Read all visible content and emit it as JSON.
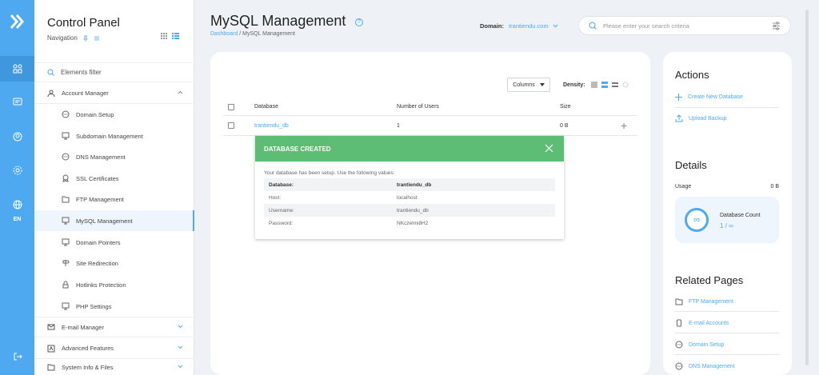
{
  "rail": {
    "lang": "EN",
    "icons": [
      "logo-icon",
      "dashboard-icon",
      "chat-icon",
      "user-icon",
      "settings-icon",
      "globe-icon",
      "logout-icon"
    ]
  },
  "nav": {
    "title": "Control Panel",
    "subtitle": "Navigation",
    "filter": "Elements filter",
    "sections": [
      {
        "label": "Account Manager"
      },
      {
        "label": "E-mail Manager"
      },
      {
        "label": "Advanced Features"
      },
      {
        "label": "System Info & Files"
      }
    ],
    "children": [
      {
        "label": "Domain Setup"
      },
      {
        "label": "Subdomain Management"
      },
      {
        "label": "DNS Management"
      },
      {
        "label": "SSL Certificates"
      },
      {
        "label": "FTP Management"
      },
      {
        "label": "MySQL Management"
      },
      {
        "label": "Domain Pointers"
      },
      {
        "label": "Site Redirection"
      },
      {
        "label": "Hotlinks Protection"
      },
      {
        "label": "PHP Settings"
      }
    ]
  },
  "header": {
    "title": "MySQL Management",
    "breadcrumb_link": "Dashboard",
    "breadcrumb_sep": "/",
    "breadcrumb_current": "MySQL Management",
    "domain_label": "Domain:",
    "domain_value": "trantiendu.com",
    "search_placeholder": "Please enter your search criteria"
  },
  "table": {
    "columns_button": "Columns",
    "density_label": "Density:",
    "headers": {
      "database": "Database",
      "users": "Number of Users",
      "size": "Size"
    },
    "rows": [
      {
        "database": "trantiendu_db",
        "users": "1",
        "size": "0 B"
      }
    ]
  },
  "modal": {
    "title": "DATABASE CREATED",
    "message": "Your database has been setup. Use the following values:",
    "fields": [
      {
        "key": "Database:",
        "value": "trantiendu_db"
      },
      {
        "key": "Host:",
        "value": "localhost"
      },
      {
        "key": "Username:",
        "value": "trantiendu_db"
      },
      {
        "key": "Password:",
        "value": "NKczelmi8H2"
      }
    ]
  },
  "actions": {
    "title": "Actions",
    "create": "Create New Database",
    "upload": "Upload Backup"
  },
  "details": {
    "title": "Details",
    "usage_label": "Usage",
    "usage_value": "0 B",
    "count_label": "Database Count",
    "count_value": "1 / ∞"
  },
  "related": {
    "title": "Related Pages",
    "items": [
      {
        "label": "FTP Management"
      },
      {
        "label": "E-mail Accounts"
      },
      {
        "label": "Domain Setup"
      },
      {
        "label": "DNS Management"
      }
    ]
  },
  "colors": {
    "accent": "#4fa9f0",
    "success": "#5dbd75"
  }
}
